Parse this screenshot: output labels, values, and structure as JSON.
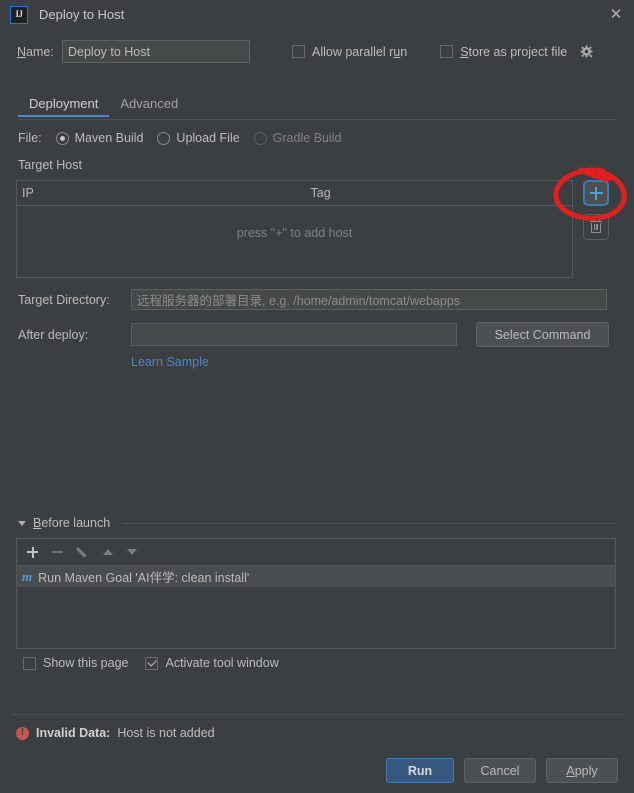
{
  "window": {
    "title": "Deploy to Host",
    "app_icon": "intellij-idea-icon",
    "close_icon": "close-icon"
  },
  "header": {
    "name_label": "Name:",
    "name_label_mnemonic": "N",
    "name_value": "Deploy to Host",
    "allow_parallel_run": {
      "label_a": "Allow parallel r",
      "label_mnemonic": "u",
      "label_b": "n",
      "checked": false
    },
    "store_as_project_file": {
      "label_mnemonic": "S",
      "label_rest": "tore as project file",
      "checked": false,
      "gear_icon": "gear-icon"
    }
  },
  "tabs": [
    {
      "label": "Deployment",
      "active": true
    },
    {
      "label": "Advanced",
      "active": false
    }
  ],
  "deployment": {
    "file_label": "File:",
    "file_options": [
      {
        "label": "Maven Build",
        "selected": true,
        "disabled": false
      },
      {
        "label": "Upload File",
        "selected": false,
        "disabled": false
      },
      {
        "label": "Gradle Build",
        "selected": false,
        "disabled": true
      }
    ],
    "target_host_label": "Target Host",
    "table": {
      "columns": [
        "IP",
        "Tag"
      ],
      "rows": [],
      "empty_text": "press \"+\" to add host"
    },
    "side_buttons": [
      {
        "icon": "plus-icon",
        "name": "add-host-button",
        "focused": true
      },
      {
        "icon": "trash-icon",
        "name": "remove-host-button",
        "focused": false
      }
    ],
    "target_directory_label": "Target Directory:",
    "target_directory_value": "",
    "target_directory_placeholder": "远程服务器的部署目录, e.g. /home/admin/tomcat/webapps",
    "after_deploy_label": "After deploy:",
    "after_deploy_value": "",
    "select_command_label": "Select Command",
    "learn_sample_label": "Learn Sample"
  },
  "before_launch": {
    "title_mnemonic": "B",
    "title_rest": "efore launch",
    "expanded": true,
    "toolbar": [
      {
        "icon": "plus-icon",
        "enabled": true
      },
      {
        "icon": "minus-icon",
        "enabled": false
      },
      {
        "icon": "pencil-icon",
        "enabled": false
      },
      {
        "icon": "arrow-up-icon",
        "enabled": false
      },
      {
        "icon": "arrow-down-icon",
        "enabled": false
      }
    ],
    "items": [
      {
        "icon": "maven-icon",
        "label": "Run Maven Goal 'AI伴学: clean install'"
      }
    ],
    "show_this_page": {
      "label": "Show this page",
      "checked": false
    },
    "activate_tool_window": {
      "label": "Activate tool window",
      "checked": true
    }
  },
  "status": {
    "icon": "error-icon",
    "prefix": "Invalid Data:",
    "message": "Host is not added"
  },
  "footer": {
    "run_label": "Run",
    "cancel_label": "Cancel",
    "apply_mnemonic": "A",
    "apply_rest": "pply"
  },
  "annotation": {
    "type": "red-circle-highlight",
    "target": "add-host-button",
    "color": "#e02020"
  },
  "colors": {
    "background": "#3c3f41",
    "field": "#45494a",
    "accent_blue": "#4a88c7",
    "primary_button": "#365880",
    "link": "#4d86cf",
    "error": "#c75450",
    "annotation_red": "#e02020"
  }
}
